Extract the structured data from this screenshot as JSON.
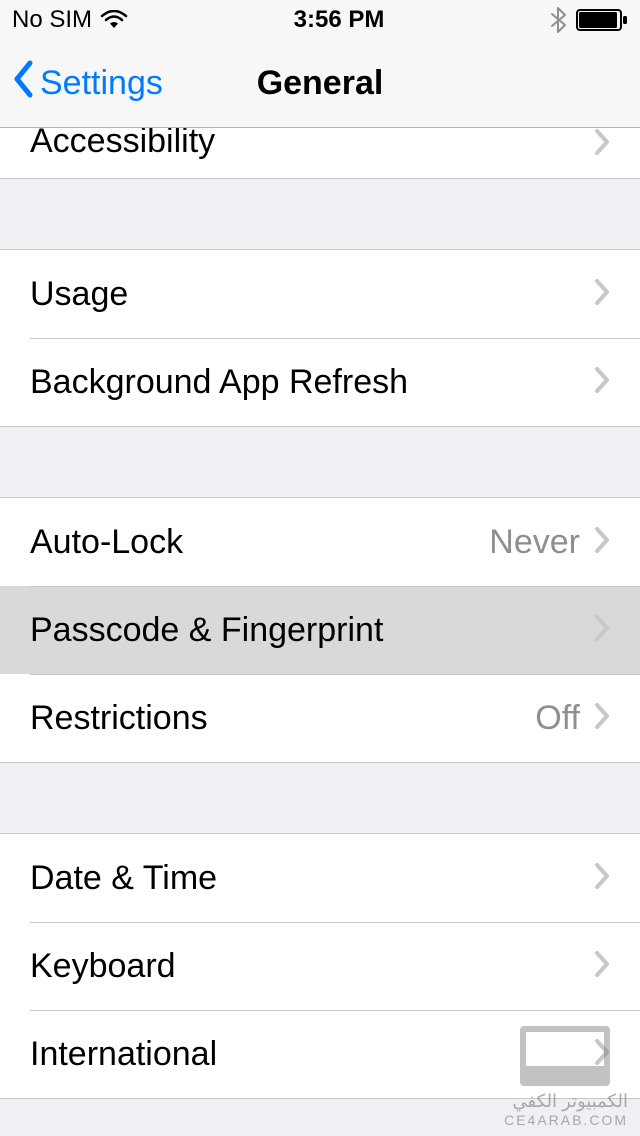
{
  "status": {
    "carrier": "No SIM",
    "time": "3:56 PM"
  },
  "nav": {
    "back_label": "Settings",
    "title": "General"
  },
  "sections": {
    "s1": {
      "accessibility": "Accessibility"
    },
    "s2": {
      "usage": "Usage",
      "background_refresh": "Background App Refresh"
    },
    "s3": {
      "autolock_label": "Auto-Lock",
      "autolock_value": "Never",
      "passcode": "Passcode & Fingerprint",
      "restrictions_label": "Restrictions",
      "restrictions_value": "Off"
    },
    "s4": {
      "datetime": "Date & Time",
      "keyboard": "Keyboard",
      "international": "International"
    }
  },
  "watermark": {
    "ar": "الكمبيوتر الكفي",
    "en": "CE4ARAB.COM"
  }
}
